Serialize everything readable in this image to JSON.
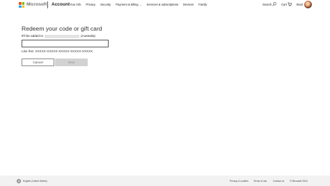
{
  "header": {
    "brand": "Microsoft",
    "section": "Account",
    "nav": [
      "Your info",
      "Privacy",
      "Security",
      "Payment & billing",
      "Services & subscriptions",
      "Devices",
      "Family"
    ],
    "search_label": "Search",
    "cart_label": "Cart",
    "user_name": "Brad",
    "logo_colors": [
      "#f25022",
      "#7fba00",
      "#00a4ef",
      "#ffb900"
    ]
  },
  "main": {
    "title": "Redeem your code or gift card",
    "added_prefix": "It'll be added to",
    "added_suffix": "(Australia)",
    "code_value": "",
    "hint": "Like this: XXXXX-XXXXX-XXXXX-XXXXX-XXXXX",
    "cancel_label": "Cancel",
    "next_label": "Next"
  },
  "footer": {
    "language": "English (United States)",
    "links": [
      "Privacy & cookies",
      "Terms of use",
      "Contact us",
      "© Microsoft 2016"
    ]
  }
}
